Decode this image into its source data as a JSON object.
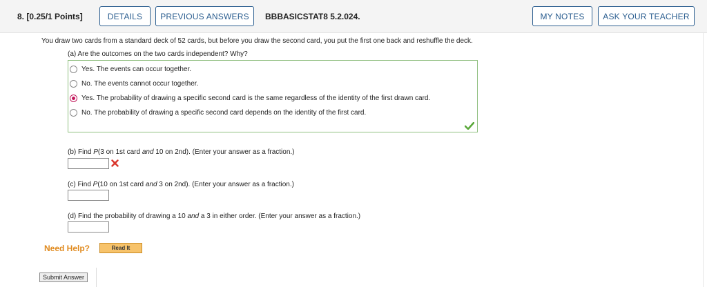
{
  "header": {
    "question_number": "8.",
    "points": "[0.25/1 Points]",
    "details_label": "DETAILS",
    "previous_answers_label": "PREVIOUS ANSWERS",
    "question_id": "BBBASICSTAT8 5.2.024.",
    "my_notes_label": "MY NOTES",
    "ask_teacher_label": "ASK YOUR TEACHER"
  },
  "prompt": "You draw two cards from a standard deck of 52 cards, but before you draw the second card, you put the first one back and reshuffle the deck.",
  "part_a": {
    "question": "(a) Are the outcomes on the two cards independent? Why?",
    "options": [
      {
        "label": "Yes. The events can occur together.",
        "selected": false
      },
      {
        "label": "No. The events cannot occur together.",
        "selected": false
      },
      {
        "label": "Yes. The probability of drawing a specific second card is the same regardless of the identity of the first drawn card.",
        "selected": true
      },
      {
        "label": "No. The probability of drawing a specific second card depends on the identity of the first card.",
        "selected": false
      }
    ],
    "status": "correct"
  },
  "part_b": {
    "pre": "(b) Find ",
    "p": "P",
    "mid1": "(3 on 1st card ",
    "and": "and",
    "post": " 10 on 2nd). (Enter your answer as a fraction.)",
    "value": "",
    "status": "incorrect"
  },
  "part_c": {
    "pre": "(c) Find ",
    "p": "P",
    "mid1": "(10 on 1st card ",
    "and": "and",
    "post": " 3 on 2nd). (Enter your answer as a fraction.)",
    "value": ""
  },
  "part_d": {
    "pre": "(d) Find the probability of drawing a 10 ",
    "and": "and",
    "post": " a 3 in either order. (Enter your answer as a fraction.)",
    "value": ""
  },
  "help": {
    "label": "Need Help?",
    "read_it_label": "Read It"
  },
  "footer": {
    "submit_label": "Submit Answer"
  },
  "colors": {
    "accent": "#2a5d8f",
    "correct_border": "#8fbf7f",
    "correct_check": "#5aa83a",
    "incorrect_x": "#d9342b",
    "selected_radio": "#c2185b",
    "need_help": "#e08a1e"
  }
}
